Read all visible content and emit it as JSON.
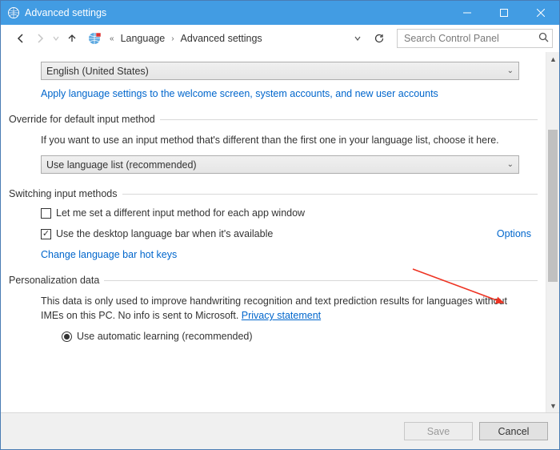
{
  "window": {
    "title": "Advanced settings"
  },
  "nav": {
    "breadcrumb": [
      "Language",
      "Advanced settings"
    ],
    "search_placeholder": "Search Control Panel"
  },
  "content": {
    "primary_lang_dropdown": "English (United States)",
    "apply_link": "Apply language settings to the welcome screen, system accounts, and new user accounts",
    "sections": {
      "override": {
        "title": "Override for default input method",
        "desc": "If you want to use an input method that's different than the first one in your language list, choose it here.",
        "dropdown": "Use language list (recommended)"
      },
      "switching": {
        "title": "Switching input methods",
        "cb1": "Let me set a different input method for each app window",
        "cb2": "Use the desktop language bar when it's available",
        "options_link": "Options",
        "hotkeys_link": "Change language bar hot keys"
      },
      "personalization": {
        "title": "Personalization data",
        "desc_pre": "This data is only used to improve handwriting recognition and text prediction results for languages without IMEs on this PC. No info is sent to Microsoft. ",
        "privacy": "Privacy statement",
        "radio1": "Use automatic learning (recommended)"
      }
    }
  },
  "footer": {
    "save": "Save",
    "cancel": "Cancel"
  }
}
